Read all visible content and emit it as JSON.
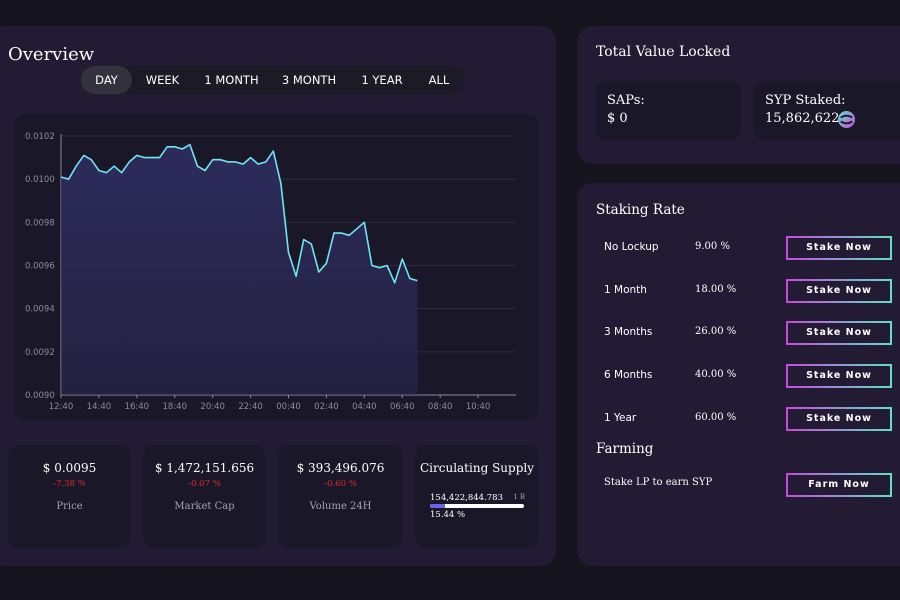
{
  "overview": {
    "title": "Overview",
    "tabs": [
      {
        "label": "DAY",
        "active": true
      },
      {
        "label": "WEEK",
        "active": false
      },
      {
        "label": "1 MONTH",
        "active": false
      },
      {
        "label": "3 MONTH",
        "active": false
      },
      {
        "label": "1 YEAR",
        "active": false
      },
      {
        "label": "ALL",
        "active": false
      }
    ]
  },
  "chart_data": {
    "type": "area",
    "title": "",
    "xlabel": "",
    "ylabel": "",
    "ylim": [
      0.009,
      0.0102
    ],
    "xlim": [
      0,
      30
    ],
    "y_ticks": [
      "0.0090",
      "0.0092",
      "0.0094",
      "0.0096",
      "0.0098",
      "0.0100",
      "0.0102"
    ],
    "x_tick_labels": [
      "12:40",
      "14:40",
      "16:40",
      "18:40",
      "20:40",
      "22:40",
      "00:40",
      "02:40",
      "04:40",
      "06:40",
      "08:40",
      "10:40"
    ],
    "line_color": "#6ee6f2",
    "fill_color": "#2e2c5e",
    "grid": true,
    "series": [
      {
        "x": [
          0,
          0.5,
          1,
          1.5,
          2,
          2.5,
          3,
          3.5,
          4,
          4.5,
          5,
          5.5,
          6,
          6.5,
          7,
          7.5,
          8,
          8.5,
          9,
          9.5,
          10,
          10.5,
          11,
          11.5,
          12,
          12.5,
          13,
          13.5,
          14,
          14.5,
          15,
          15.5,
          16,
          16.5,
          17,
          17.5,
          18,
          18.5,
          19,
          19.5,
          20,
          20.5,
          21,
          21.5,
          22,
          22.5,
          23,
          23.5,
          24,
          24.5,
          25,
          25.5,
          26,
          26.5,
          27
        ],
        "y": [
          0.01001,
          0.01,
          0.01006,
          0.01011,
          0.01009,
          0.01004,
          0.01003,
          0.01006,
          0.01003,
          0.01008,
          0.01011,
          0.0101,
          0.0101,
          0.0101,
          0.01015,
          0.01015,
          0.01014,
          0.01016,
          0.01006,
          0.01004,
          0.01009,
          0.01009,
          0.01008,
          0.01008,
          0.01007,
          0.0101,
          0.01007,
          0.01008,
          0.01013,
          0.00998,
          0.00966,
          0.00955,
          0.00972,
          0.0097,
          0.00957,
          0.00961,
          0.00975,
          0.00975,
          0.00974,
          0.00977,
          0.0098,
          0.0096,
          0.00959,
          0.0096,
          0.00952,
          0.00963,
          0.00954,
          0.00953,
          null,
          null,
          null,
          null,
          null,
          null,
          null
        ]
      }
    ]
  },
  "stats": {
    "price": {
      "value": "$ 0.0095",
      "change": "-7.38 %",
      "label": "Price"
    },
    "market_cap": {
      "value": "$ 1,472,151.656",
      "change": "-0.07 %",
      "label": "Market Cap"
    },
    "volume": {
      "value": "$ 393,496.076",
      "change": "-0.60 %",
      "label": "Volume 24H"
    },
    "supply": {
      "title": "Circulating Supply",
      "amount": "154,422,844.783",
      "max": "1 B",
      "percent": "15.44 %",
      "fraction": 0.1544
    }
  },
  "tvl": {
    "title": "Total Value Locked",
    "saps_label": "SAPs:",
    "saps_value": "$ 0",
    "syp_label": "SYP Staked:",
    "syp_value": "15,862,622",
    "syp_icon": "syp-token-icon"
  },
  "staking": {
    "title": "Staking Rate",
    "rows": [
      {
        "term": "No Lockup",
        "rate": "9.00 %",
        "button": "Stake Now"
      },
      {
        "term": "1 Month",
        "rate": "18.00 %",
        "button": "Stake Now"
      },
      {
        "term": "3 Months",
        "rate": "26.00 %",
        "button": "Stake Now"
      },
      {
        "term": "6 Months",
        "rate": "40.00 %",
        "button": "Stake Now"
      },
      {
        "term": "1 Year",
        "rate": "60.00 %",
        "button": "Stake Now"
      }
    ]
  },
  "farming": {
    "title": "Farming",
    "label": "Stake LP to earn SYP",
    "button": "Farm Now"
  },
  "colors": {
    "background": "#16141f",
    "panel": "#221b33",
    "card": "#1a1828",
    "negative": "#e02a2a",
    "button_gradient_start": "#c64bd9",
    "button_gradient_end": "#5fe0c8"
  }
}
